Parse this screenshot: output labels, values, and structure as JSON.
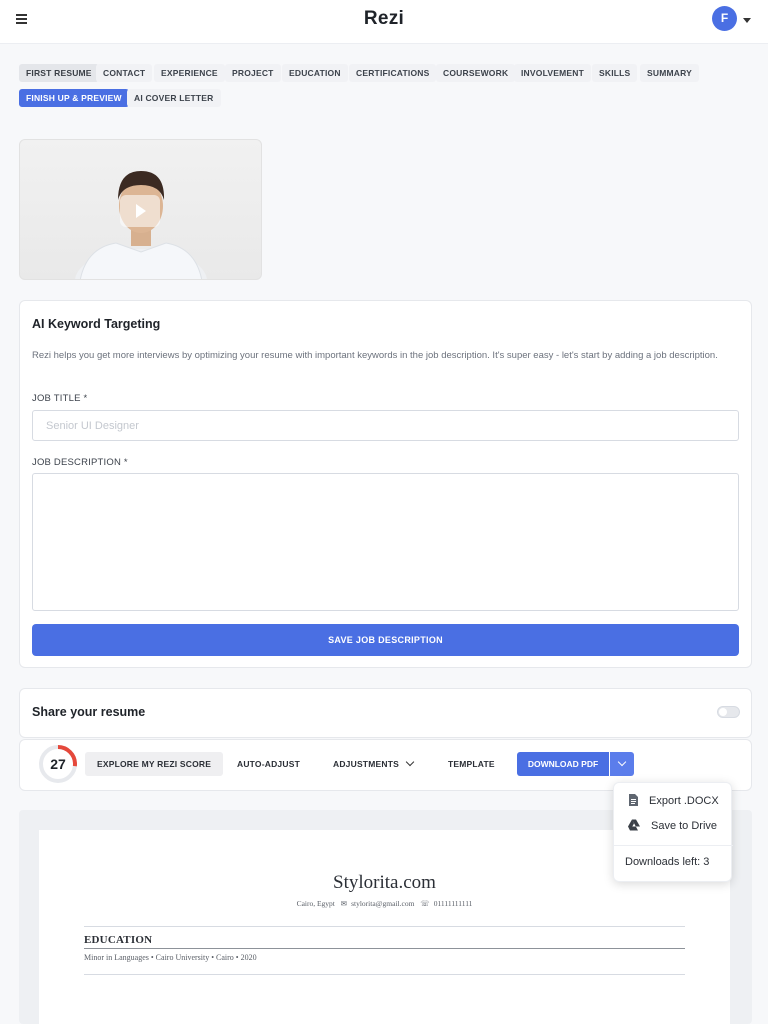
{
  "header": {
    "brand": "Rezi",
    "avatar_initial": "F",
    "menu_icon": "menu-icon"
  },
  "tabs": [
    {
      "label": "FIRST RESUME",
      "state": "selected"
    },
    {
      "label": "CONTACT",
      "state": "normal"
    },
    {
      "label": "EXPERIENCE",
      "state": "normal"
    },
    {
      "label": "PROJECT",
      "state": "normal"
    },
    {
      "label": "EDUCATION",
      "state": "normal"
    },
    {
      "label": "CERTIFICATIONS",
      "state": "normal"
    },
    {
      "label": "COURSEWORK",
      "state": "normal"
    },
    {
      "label": "INVOLVEMENT",
      "state": "normal"
    },
    {
      "label": "SKILLS",
      "state": "normal"
    },
    {
      "label": "SUMMARY",
      "state": "normal"
    },
    {
      "label": "FINISH UP & PREVIEW",
      "state": "active"
    },
    {
      "label": "AI COVER LETTER",
      "state": "normal"
    }
  ],
  "video": {
    "play_icon": "play-icon"
  },
  "keyword_card": {
    "title": "AI Keyword Targeting",
    "description": "Rezi helps you get more interviews by optimizing your resume with important keywords in the job description. It's super easy - let's start by adding a job description.",
    "job_title_label": "JOB TITLE *",
    "job_title_placeholder": "Senior UI Designer",
    "job_title_value": "",
    "job_description_label": "JOB DESCRIPTION *",
    "job_description_value": "",
    "save_button": "SAVE JOB DESCRIPTION"
  },
  "share_card": {
    "title": "Share your resume",
    "toggle_on": false
  },
  "toolbar": {
    "score": "27",
    "score_fraction": 0.27,
    "score_color": "#e5483b",
    "explore_button": "EXPLORE MY REZI SCORE",
    "auto_adjust": "AUTO-ADJUST",
    "adjustments": "ADJUSTMENTS",
    "template": "TEMPLATE",
    "download_pdf": "DOWNLOAD PDF"
  },
  "download_menu": {
    "export_docx": "Export .DOCX",
    "save_drive": "Save to Drive",
    "downloads_left": "Downloads left: 3"
  },
  "resume": {
    "name": "Stylorita.com",
    "location": "Cairo,  Egypt",
    "email": "stylorita@gmail.com",
    "phone": "01111111111",
    "section_heading": "EDUCATION",
    "education_line": "Minor in Languages  • Cairo University  • Cairo  • 2020"
  },
  "colors": {
    "accent": "#4a6fe3",
    "background": "#f7f8fa",
    "score_ring": "#e5483b"
  }
}
